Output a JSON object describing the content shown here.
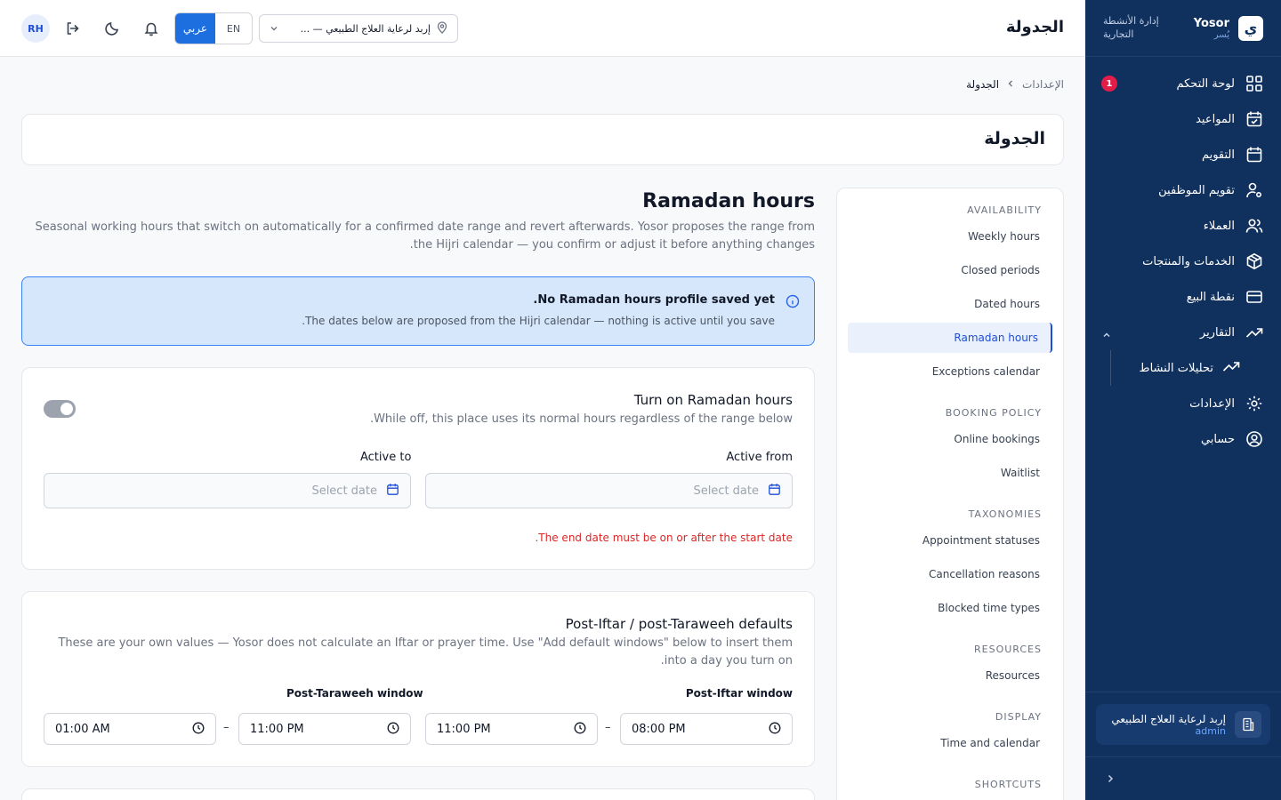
{
  "sidebar": {
    "brand_en": "Yosor",
    "brand_ar": "يُسر",
    "logo_glyph": "ي",
    "subtitle": "إدارة الأنشطة التجارية",
    "items": [
      {
        "label": "لوحة التحكم",
        "icon": "grid-icon",
        "badge": "1"
      },
      {
        "label": "المواعيد",
        "icon": "calendar-check-icon"
      },
      {
        "label": "التقويم",
        "icon": "calendar-icon"
      },
      {
        "label": "تقويم الموظفين",
        "icon": "user-cog-icon"
      },
      {
        "label": "العملاء",
        "icon": "users-icon"
      },
      {
        "label": "الخدمات والمنتجات",
        "icon": "package-icon"
      },
      {
        "label": "نقطة البيع",
        "icon": "credit-card-icon"
      },
      {
        "label": "التقارير",
        "icon": "trending-up-icon"
      }
    ],
    "sub_items": [
      {
        "label": "تحليلات النشاط",
        "icon": "trending-up-icon"
      }
    ],
    "bottom_items": [
      {
        "label": "الإعدادات",
        "icon": "gear-icon"
      },
      {
        "label": "حسابي",
        "icon": "user-circle-icon"
      }
    ],
    "org": {
      "name": "إربد لرعاية العلاج الطبيعي",
      "role": "admin"
    }
  },
  "topbar": {
    "title": "الجدولة",
    "avatar": "RH",
    "lang_ar": "عربي",
    "lang_en": "EN",
    "location": "إربد لرعاية العلاج الطبيعي — ..."
  },
  "breadcrumb": {
    "parent": "الإعدادات",
    "current": "الجدولة"
  },
  "page_title": "الجدولة",
  "settings_nav": {
    "groups": [
      {
        "title": "AVAILABILITY",
        "items": [
          "Weekly hours",
          "Closed periods",
          "Dated hours",
          "Ramadan hours",
          "Exceptions calendar"
        ]
      },
      {
        "title": "BOOKING POLICY",
        "items": [
          "Online bookings",
          "Waitlist"
        ]
      },
      {
        "title": "TAXONOMIES",
        "items": [
          "Appointment statuses",
          "Cancellation reasons",
          "Blocked time types"
        ]
      },
      {
        "title": "RESOURCES",
        "items": [
          "Resources"
        ]
      },
      {
        "title": "DISPLAY",
        "items": [
          "Time and calendar"
        ]
      },
      {
        "title": "SHORTCUTS",
        "items": []
      }
    ],
    "active": "Ramadan hours"
  },
  "section": {
    "title": "Ramadan hours",
    "description": "Seasonal working hours that switch on automatically for a confirmed date range and revert afterwards. Yosor proposes the range from the Hijri calendar — you confirm or adjust it before anything changes."
  },
  "alert": {
    "title": "No Ramadan hours profile saved yet.",
    "text": "The dates below are proposed from the Hijri calendar — nothing is active until you save."
  },
  "toggle_card": {
    "title": "Turn on Ramadan hours",
    "description": "While off, this place uses its normal hours regardless of the range below.",
    "enabled": false,
    "active_from_label": "Active from",
    "active_to_label": "Active to",
    "date_placeholder": "Select date",
    "error": "The end date must be on or after the start date."
  },
  "defaults_card": {
    "title": "Post-Iftar / post-Taraweeh defaults",
    "description": "These are your own values — Yosor does not calculate an Iftar or prayer time. Use \"Add default windows\" below to insert them into a day you turn on.",
    "iftar_label": "Post-Iftar window",
    "taraweeh_label": "Post-Taraweeh window",
    "iftar_from": "08:00 PM",
    "iftar_to": "11:00 PM",
    "taraweeh_from": "11:00 PM",
    "taraweeh_to": "01:00 AM"
  },
  "colors": {
    "sidebar_bg": "#10305e",
    "accent": "#1d6fe0",
    "error": "#dc2626",
    "alert_bg": "#d7e7fb"
  }
}
